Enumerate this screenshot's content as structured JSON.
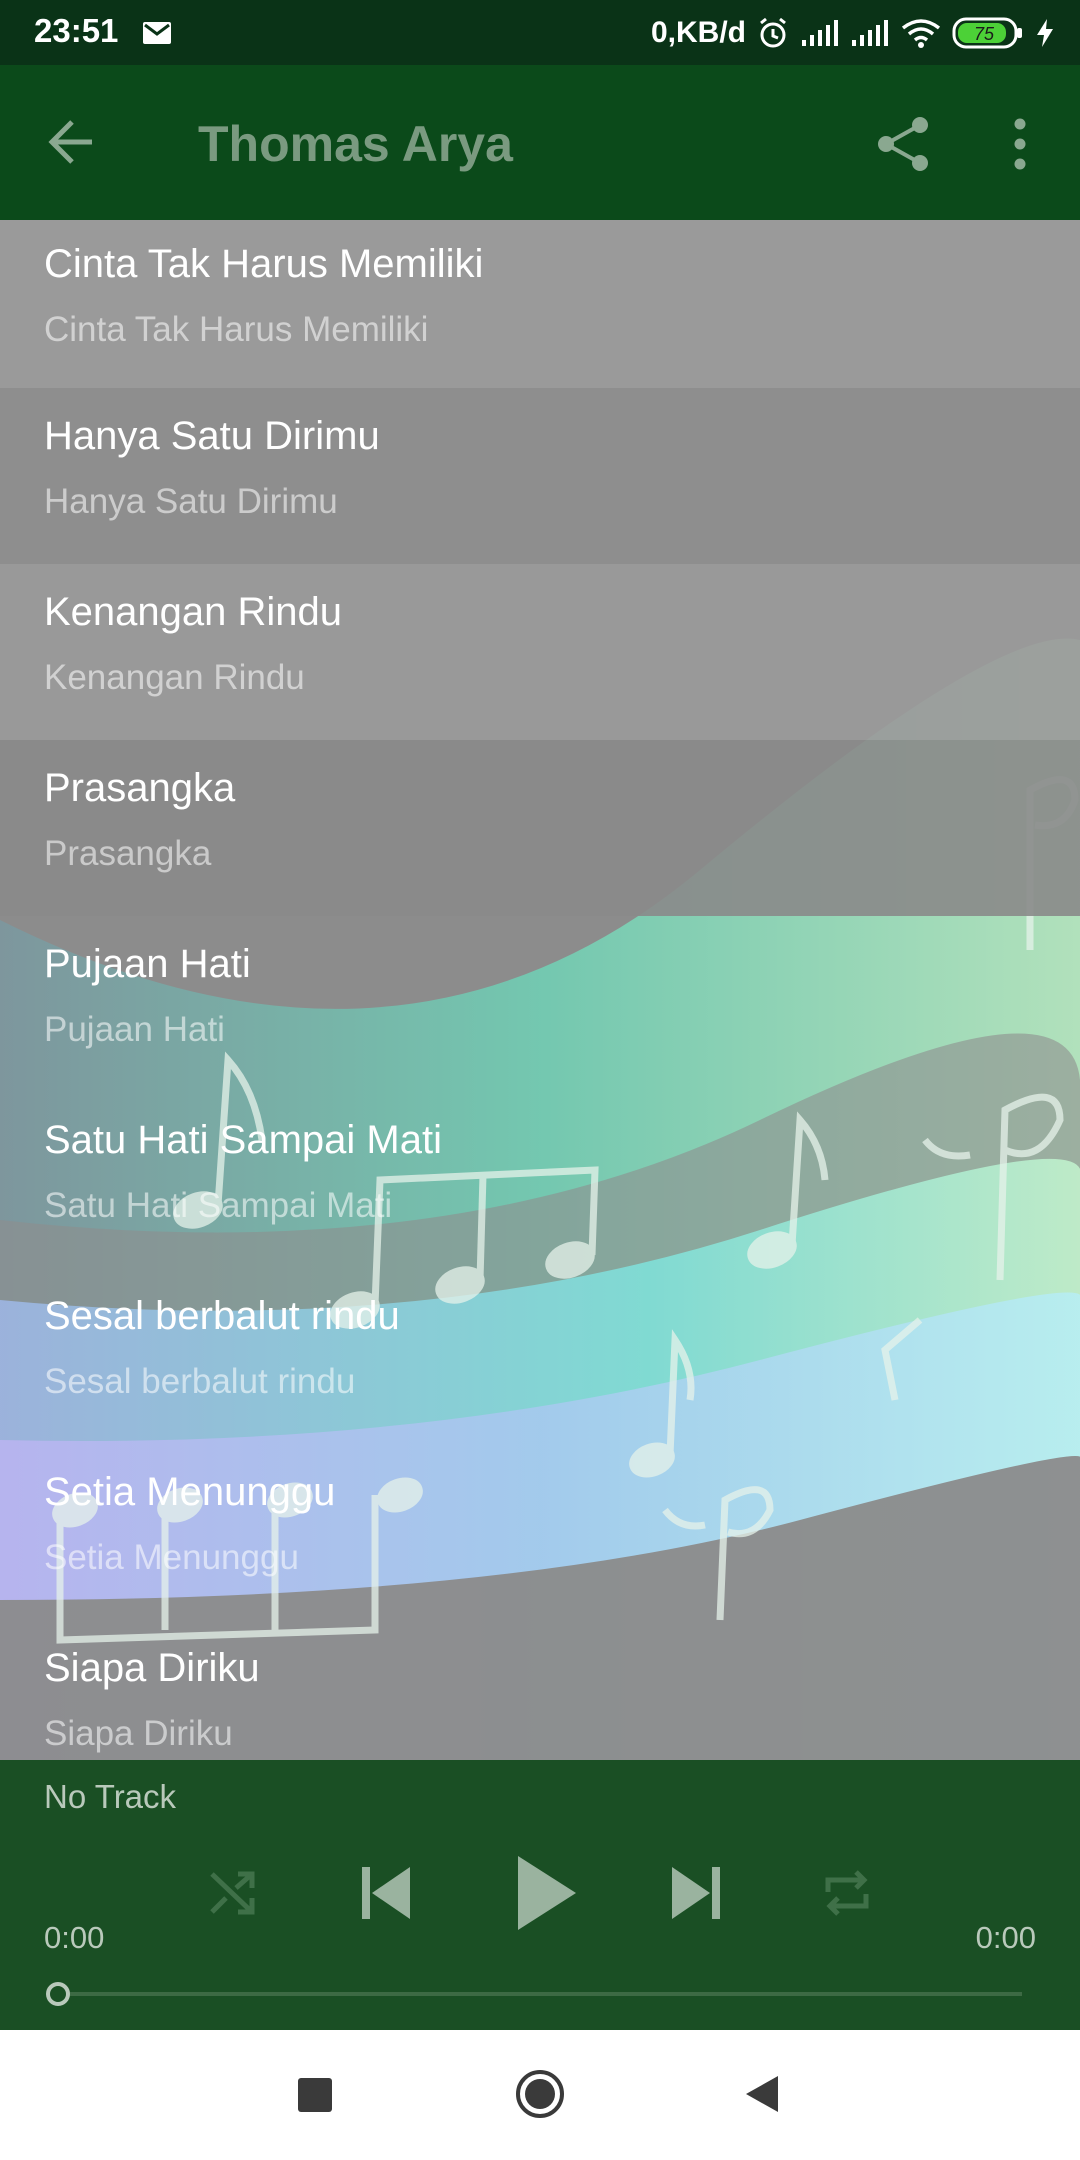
{
  "status_bar": {
    "time": "23:51",
    "net_speed": "0,KB/d",
    "battery_level": "75",
    "icons": [
      "mail-icon",
      "alarm-icon",
      "signal-icon",
      "signal-icon",
      "wifi-icon",
      "battery-icon",
      "charging-icon"
    ]
  },
  "app_bar": {
    "title": "Thomas Arya",
    "icons": [
      "back-arrow-icon",
      "share-icon",
      "more-vert-icon"
    ]
  },
  "tracks": [
    {
      "title": "Cinta Tak Harus Memiliki",
      "subtitle": "Cinta Tak Harus Memiliki"
    },
    {
      "title": "Hanya Satu Dirimu",
      "subtitle": "Hanya Satu Dirimu"
    },
    {
      "title": "Kenangan Rindu",
      "subtitle": "Kenangan Rindu"
    },
    {
      "title": "Prasangka",
      "subtitle": "Prasangka"
    },
    {
      "title": "Pujaan Hati",
      "subtitle": "Pujaan Hati"
    },
    {
      "title": "Satu Hati Sampai Mati",
      "subtitle": "Satu Hati Sampai Mati"
    },
    {
      "title": "Sesal berbalut rindu",
      "subtitle": "Sesal berbalut rindu"
    },
    {
      "title": "Setia Menunggu",
      "subtitle": "Setia Menunggu"
    },
    {
      "title": "Siapa Diriku",
      "subtitle": "Siapa Diriku"
    }
  ],
  "player": {
    "now_playing": "No Track",
    "elapsed": "0:00",
    "total": "0:00",
    "progress": 0,
    "icons": [
      "shuffle-icon",
      "skip-previous-icon",
      "play-icon",
      "skip-next-icon",
      "repeat-icon"
    ]
  },
  "colors": {
    "status_bar": "#0a3317",
    "app_bar": "#0b4a1a",
    "player": "#1a4f24",
    "title_text": "#7a9a80"
  }
}
